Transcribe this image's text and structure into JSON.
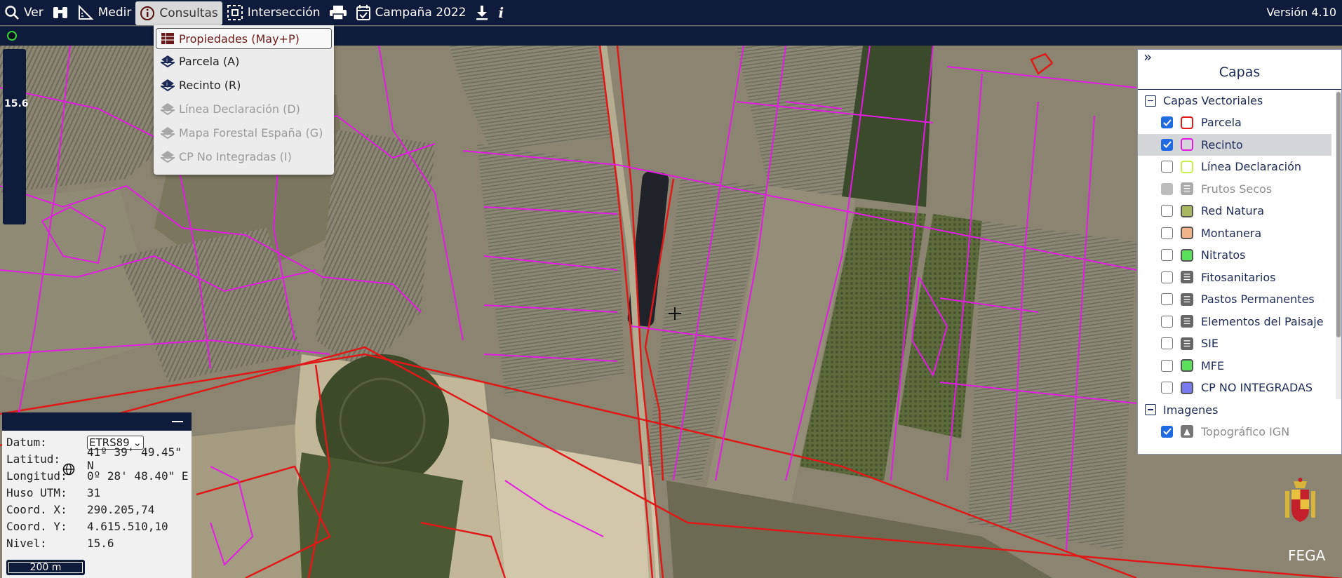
{
  "toolbar": {
    "ver": "Ver",
    "medir": "Medir",
    "consultas": "Consultas",
    "interseccion": "Intersección",
    "campana": "Campaña 2022",
    "version": "Versión 4.10"
  },
  "consultas_menu": {
    "items": [
      {
        "label": "Propiedades (May+P)",
        "enabled": true
      },
      {
        "label": "Parcela (A)",
        "enabled": true
      },
      {
        "label": "Recinto (R)",
        "enabled": true
      },
      {
        "label": "Línea Declaración (D)",
        "enabled": false
      },
      {
        "label": "Mapa Forestal España (G)",
        "enabled": false
      },
      {
        "label": "CP No Integradas (I)",
        "enabled": false
      }
    ]
  },
  "zoom": {
    "level": "15.6"
  },
  "layers_panel": {
    "title": "Capas",
    "vector_group": "Capas Vectoriales",
    "layers": [
      {
        "label": "Parcela",
        "checked": true,
        "swatch": "#e01818"
      },
      {
        "label": "Recinto",
        "checked": true,
        "swatch": "#e018e0"
      },
      {
        "label": "Línea Declaración",
        "checked": false,
        "swatch": "#c8f04a"
      },
      {
        "label": "Frutos Secos",
        "checked": false,
        "icon": "list-icon"
      },
      {
        "label": "Red Natura",
        "checked": false,
        "swatch": "#a7b860"
      },
      {
        "label": "Montanera",
        "checked": false,
        "swatch": "#f3b48a"
      },
      {
        "label": "Nitratos",
        "checked": false,
        "swatch": "#5be05b"
      },
      {
        "label": "Fitosanitarios",
        "checked": false,
        "icon": "list-icon"
      },
      {
        "label": "Pastos Permanentes",
        "checked": false,
        "icon": "list-icon"
      },
      {
        "label": "Elementos del Paisaje",
        "checked": false,
        "icon": "list-icon"
      },
      {
        "label": "SIE",
        "checked": false,
        "icon": "list-icon"
      },
      {
        "label": "MFE",
        "checked": false,
        "swatch": "#5be05b"
      },
      {
        "label": "CP NO INTEGRADAS",
        "checked": false,
        "swatch": "#7a7af0"
      }
    ],
    "image_group": "Imagenes",
    "image_layers": [
      {
        "label": "Topográfico IGN",
        "checked": true,
        "icon": "image-icon"
      }
    ]
  },
  "coords_panel": {
    "datum_label": "Datum:",
    "datum_value": "ETRS89",
    "lat_label": "Latitud:",
    "lat_value": "41º 39' 49.45\" N",
    "lon_label": "Longitud:",
    "lon_value": "0º 28' 48.40\" E",
    "huso_label": "Huso UTM:",
    "huso_value": "31",
    "x_label": "Coord. X:",
    "x_value": "290.205,74",
    "y_label": "Coord. Y:",
    "y_value": "4.615.510,10",
    "nivel_label": "Nivel:",
    "nivel_value": "15.6",
    "scale": "200 m"
  },
  "branding": {
    "fega": "FEGA"
  }
}
